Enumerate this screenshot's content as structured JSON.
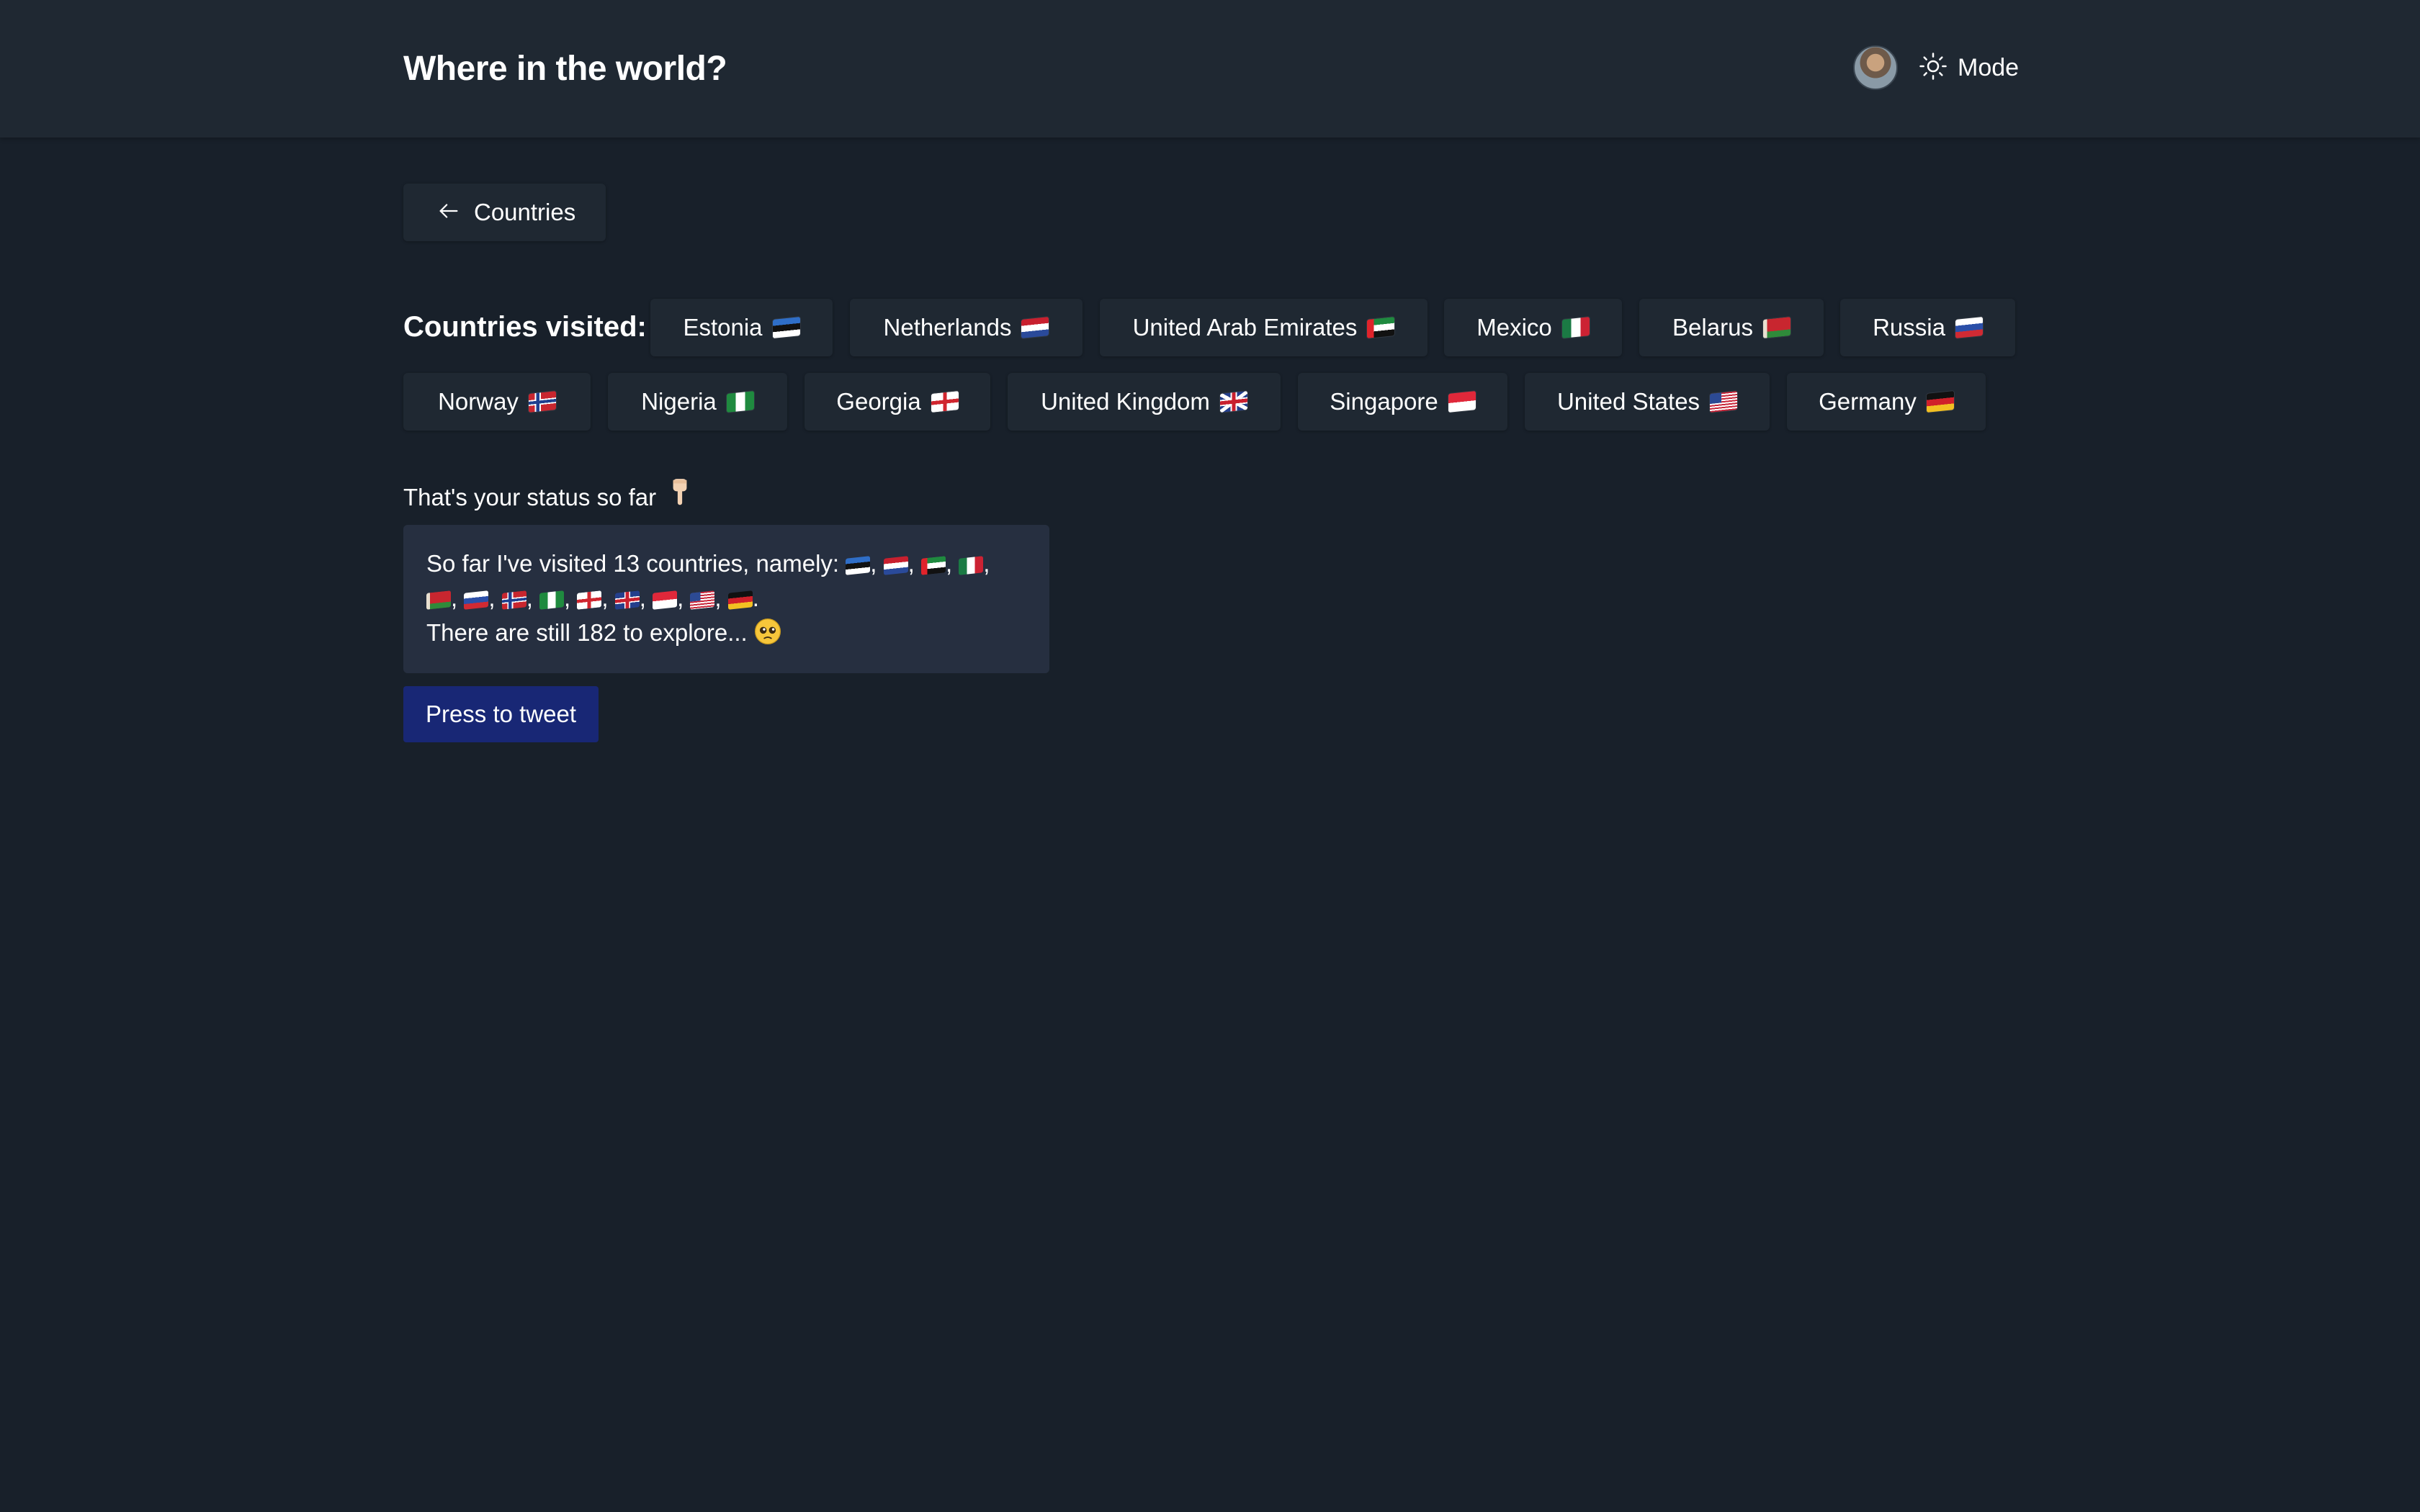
{
  "header": {
    "title": "Where in the world?",
    "mode_label": "Mode"
  },
  "back_button": {
    "label": "Countries"
  },
  "visited": {
    "label": "Countries visited:",
    "countries": [
      {
        "name": "Estonia",
        "flag": "EE"
      },
      {
        "name": "Netherlands",
        "flag": "NL"
      },
      {
        "name": "United Arab Emirates",
        "flag": "AE"
      },
      {
        "name": "Mexico",
        "flag": "MX"
      },
      {
        "name": "Belarus",
        "flag": "BY"
      },
      {
        "name": "Russia",
        "flag": "RU"
      },
      {
        "name": "Norway",
        "flag": "NO"
      },
      {
        "name": "Nigeria",
        "flag": "NG"
      },
      {
        "name": "Georgia",
        "flag": "GE"
      },
      {
        "name": "United Kingdom",
        "flag": "GB"
      },
      {
        "name": "Singapore",
        "flag": "SG"
      },
      {
        "name": "United States",
        "flag": "US"
      },
      {
        "name": "Germany",
        "flag": "DE"
      }
    ]
  },
  "status": {
    "label": "That's your status so far",
    "label_icon": "pointing-down-icon",
    "line1_prefix": "So far I've visited 13 countries, namely:",
    "line3": "There are still 182 to explore...",
    "line3_icon": "pleading-face-icon"
  },
  "tweet_button": {
    "label": "Press to tweet"
  },
  "colors": {
    "background": "#18202a",
    "header": "#1f2832",
    "chip": "#1f2832",
    "status_box": "#262f40",
    "tweet_button": "#182775"
  }
}
